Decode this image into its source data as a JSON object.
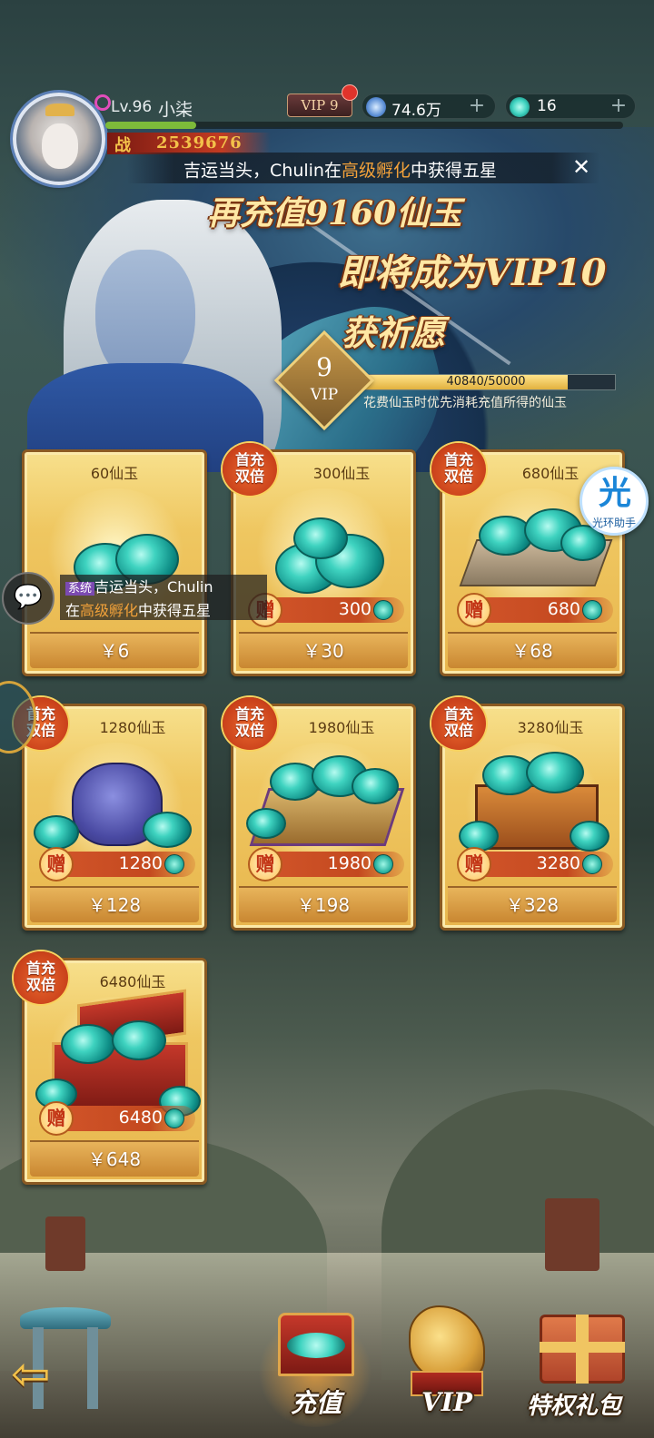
{
  "player": {
    "level": "Lv.96",
    "name": "小柒",
    "power": "2539676"
  },
  "vip_badge": "VIP 9",
  "currency": [
    {
      "icon": "spirit-gem-icon",
      "value": "74.6万"
    },
    {
      "icon": "jade-coin-icon",
      "value": "16"
    }
  ],
  "announcement": {
    "prefix": "吉运当头，",
    "player": "Chulin",
    "mid": "在",
    "event": "高级孵化",
    "suffix": "中获得五星"
  },
  "promo": {
    "line1": "再充值9160仙玉",
    "line2": "即将成为VIP10",
    "line3": "获祈愿"
  },
  "vip_progress": {
    "level": "9",
    "label": "VIP",
    "text": "40840/50000",
    "current": 40840,
    "max": 50000,
    "note": "花费仙玉时优先消耗充值所得的仙玉"
  },
  "products": [
    {
      "title": "60仙玉",
      "price": "￥6",
      "double": false,
      "bonus": ""
    },
    {
      "title": "300仙玉",
      "price": "￥30",
      "double": true,
      "bonus": "300"
    },
    {
      "title": "680仙玉",
      "price": "￥68",
      "double": true,
      "bonus": "680"
    },
    {
      "title": "1280仙玉",
      "price": "￥128",
      "double": true,
      "bonus": "1280"
    },
    {
      "title": "1980仙玉",
      "price": "￥198",
      "double": true,
      "bonus": "1980"
    },
    {
      "title": "3280仙玉",
      "price": "￥328",
      "double": true,
      "bonus": "3280"
    },
    {
      "title": "6480仙玉",
      "price": "￥648",
      "double": true,
      "bonus": "6480"
    }
  ],
  "double_badge": {
    "line1": "首充",
    "line2": "双倍"
  },
  "gift_label": "赠",
  "chat": {
    "tag": "系统",
    "line1_rest": "吉运当头，Chulin",
    "line2_a": "在",
    "line2_event": "高级孵化",
    "line2_b": "中获得五星"
  },
  "helper": {
    "glyph": "光",
    "label": "光环助手"
  },
  "nav": [
    {
      "label": "充值",
      "icon": "recharge-chest-icon",
      "active": true
    },
    {
      "label": "VIP",
      "icon": "vip-dragon-icon",
      "active": false
    },
    {
      "label": "特权礼包",
      "icon": "privilege-giftbox-icon",
      "active": false
    }
  ],
  "colors": {
    "accent_gold": "#f0c562",
    "highlight_orange": "#f3a23a",
    "card_border": "#8b5a22",
    "jade": "#3fd3c0"
  }
}
